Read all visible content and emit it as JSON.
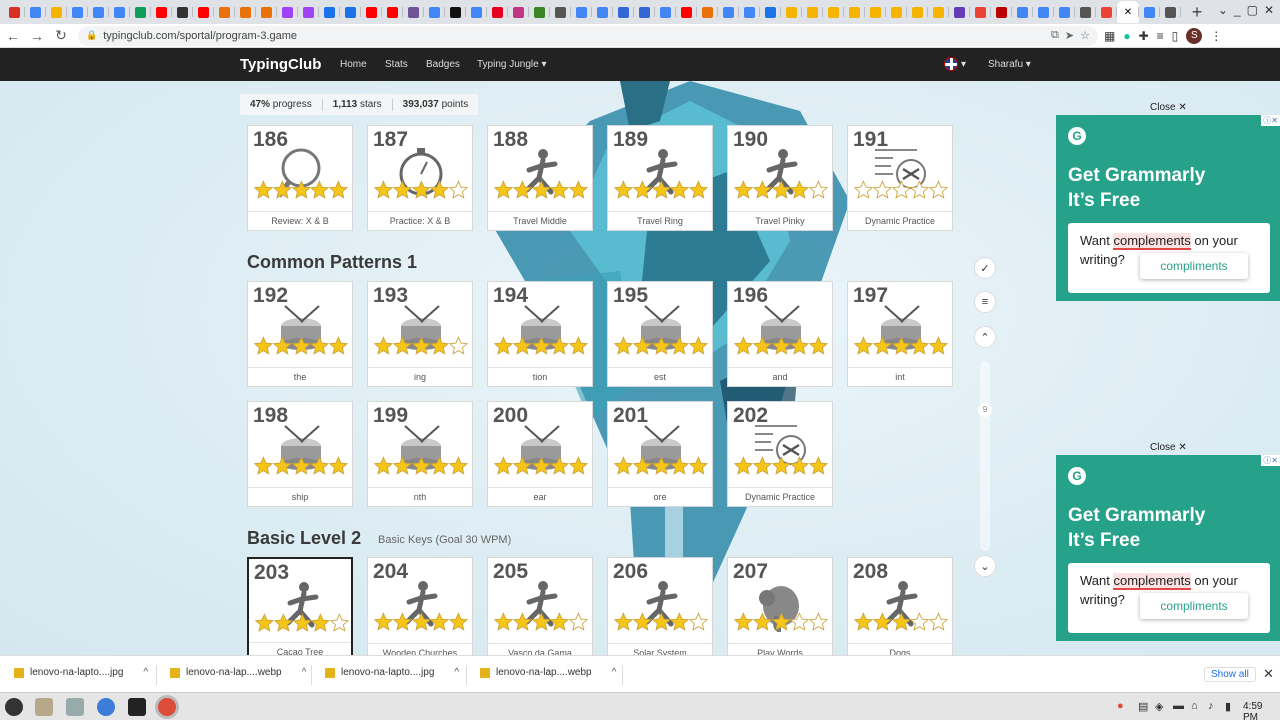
{
  "browser": {
    "url": "typingclub.com/sportal/program-3.game",
    "tab_favicon_colors": [
      "#d93025",
      "#4285f4",
      "#f4b400",
      "#4285f4",
      "#4285f4",
      "#4285f4",
      "#0f9d58",
      "#ff0000",
      "#333",
      "#ff0000",
      "#e8710a",
      "#e8710a",
      "#e8710a",
      "#a142f4",
      "#a142f4",
      "#1a73e8",
      "#1a73e8",
      "#ff0000",
      "#ff0000",
      "#6e5494",
      "#4285f4",
      "#111",
      "#4285f4",
      "#e60023",
      "#c13584",
      "#3b8526",
      "#555",
      "#4285f4",
      "#4285f4",
      "#3367d6",
      "#3367d6",
      "#4285f4",
      "#ff0000",
      "#e8710a",
      "#4285f4",
      "#4285f4",
      "#1a73e8",
      "#f4b400",
      "#f4b400",
      "#f4b400",
      "#f4b400",
      "#f4b400",
      "#f4b400",
      "#f4b400",
      "#f4b400",
      "#673ab7",
      "#ea4335",
      "#b00",
      "#4285f4",
      "#4285f4",
      "#4285f4",
      "#555",
      "#ea4335",
      "#4285f4",
      "#555"
    ]
  },
  "nav": {
    "brand": "TypingClub",
    "links": [
      "Home",
      "Stats",
      "Badges",
      "Typing Jungle"
    ],
    "user": "Sharafu"
  },
  "progress": {
    "percent": "47%",
    "percent_label": "progress",
    "stars": "1,113",
    "stars_label": "stars",
    "points": "393,037",
    "points_label": "points"
  },
  "sections": [
    {
      "title": "Common Patterns 1",
      "subtitle": ""
    },
    {
      "title": "Basic Level 2",
      "subtitle": "Basic Keys (Goal 30 WPM)"
    }
  ],
  "lessons": [
    {
      "num": "186",
      "title": "Review: X & B",
      "icon": "magnifier-icon",
      "stars": 5
    },
    {
      "num": "187",
      "title": "Practice: X & B",
      "icon": "stopwatch-icon",
      "stars": 4
    },
    {
      "num": "188",
      "title": "Travel Middle",
      "icon": "runner-icon",
      "stars": 5
    },
    {
      "num": "189",
      "title": "Travel Ring",
      "icon": "runner-icon",
      "stars": 5
    },
    {
      "num": "190",
      "title": "Travel Pinky",
      "icon": "runner-icon",
      "stars": 4
    },
    {
      "num": "191",
      "title": "Dynamic Practice",
      "icon": "shuffle-icon",
      "stars": 0
    },
    {
      "num": "192",
      "title": "the",
      "icon": "drum-icon",
      "stars": 5
    },
    {
      "num": "193",
      "title": "ing",
      "icon": "drum-icon",
      "stars": 4
    },
    {
      "num": "194",
      "title": "tion",
      "icon": "drum-icon",
      "stars": 5
    },
    {
      "num": "195",
      "title": "est",
      "icon": "drum-icon",
      "stars": 5
    },
    {
      "num": "196",
      "title": "and",
      "icon": "drum-icon",
      "stars": 5
    },
    {
      "num": "197",
      "title": "int",
      "icon": "drum-icon",
      "stars": 5
    },
    {
      "num": "198",
      "title": "ship",
      "icon": "drum-icon",
      "stars": 5
    },
    {
      "num": "199",
      "title": "nth",
      "icon": "drum-icon",
      "stars": 5
    },
    {
      "num": "200",
      "title": "ear",
      "icon": "drum-icon",
      "stars": 5
    },
    {
      "num": "201",
      "title": "ore",
      "icon": "drum-icon",
      "stars": 5
    },
    {
      "num": "202",
      "title": "Dynamic Practice",
      "icon": "shuffle-icon",
      "stars": 5
    },
    {
      "num": "203",
      "title": "Cacao Tree",
      "icon": "runner-icon",
      "stars": 4
    },
    {
      "num": "204",
      "title": "Wooden Churches",
      "icon": "runner-icon",
      "stars": 5
    },
    {
      "num": "205",
      "title": "Vasco da Gama",
      "icon": "runner-icon",
      "stars": 4
    },
    {
      "num": "206",
      "title": "Solar System",
      "icon": "runner-icon",
      "stars": 4
    },
    {
      "num": "207",
      "title": "Play Words",
      "icon": "elephant-icon",
      "stars": 3
    },
    {
      "num": "208",
      "title": "Dogs",
      "icon": "runner-icon",
      "stars": 3
    }
  ],
  "side": {
    "scroll_index": "9"
  },
  "ads": [
    {
      "close": "Close",
      "headline_1": "Get Grammarly",
      "headline_2": "It’s Free",
      "text_1": "Want ",
      "text_word": "complements",
      "text_2": " on your writing?",
      "suggestion": "compliments"
    },
    {
      "close": "Close",
      "headline_1": "Get Grammarly",
      "headline_2": "It’s Free",
      "text_1": "Want ",
      "text_word": "complements",
      "text_2": " on your writing?",
      "suggestion": "compliments"
    }
  ],
  "downloads": {
    "items": [
      "lenovo-na-lapto....jpg",
      "lenovo-na-lap....webp",
      "lenovo-na-lapto....jpg",
      "lenovo-na-lap....webp"
    ],
    "show_all": "Show all"
  },
  "taskbar": {
    "time": "4:59 PM"
  }
}
